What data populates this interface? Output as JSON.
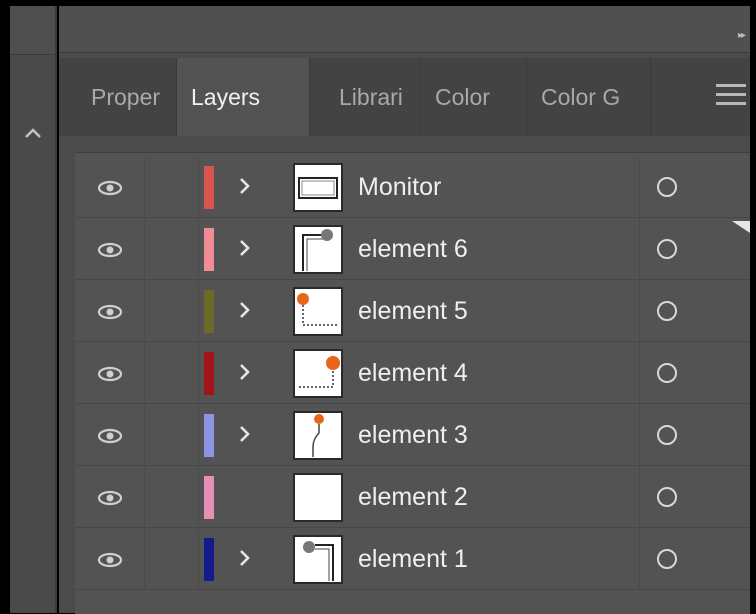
{
  "panel": {
    "tabs": [
      {
        "label": "Proper",
        "active": false
      },
      {
        "label": "Layers",
        "active": true
      },
      {
        "label": "Librari",
        "active": false
      },
      {
        "label": "Color",
        "active": false
      },
      {
        "label": "Color G",
        "active": false
      }
    ],
    "icons": {
      "expand": "double-chevron-right-icon",
      "menu": "hamburger-menu-icon",
      "collapse": "chevron-up-icon"
    }
  },
  "layers": [
    {
      "name": "Monitor",
      "color": "#d9534f",
      "expandable": true,
      "visible": true
    },
    {
      "name": "element 6",
      "color": "#ef8c95",
      "expandable": true,
      "visible": true
    },
    {
      "name": "element 5",
      "color": "#6b6b28",
      "expandable": true,
      "visible": true
    },
    {
      "name": "element 4",
      "color": "#a3141a",
      "expandable": true,
      "visible": true
    },
    {
      "name": "element 3",
      "color": "#8f93e8",
      "expandable": true,
      "visible": true
    },
    {
      "name": "element 2",
      "color": "#e88fb6",
      "expandable": false,
      "visible": true
    },
    {
      "name": "element 1",
      "color": "#151a8a",
      "expandable": true,
      "visible": true
    }
  ]
}
